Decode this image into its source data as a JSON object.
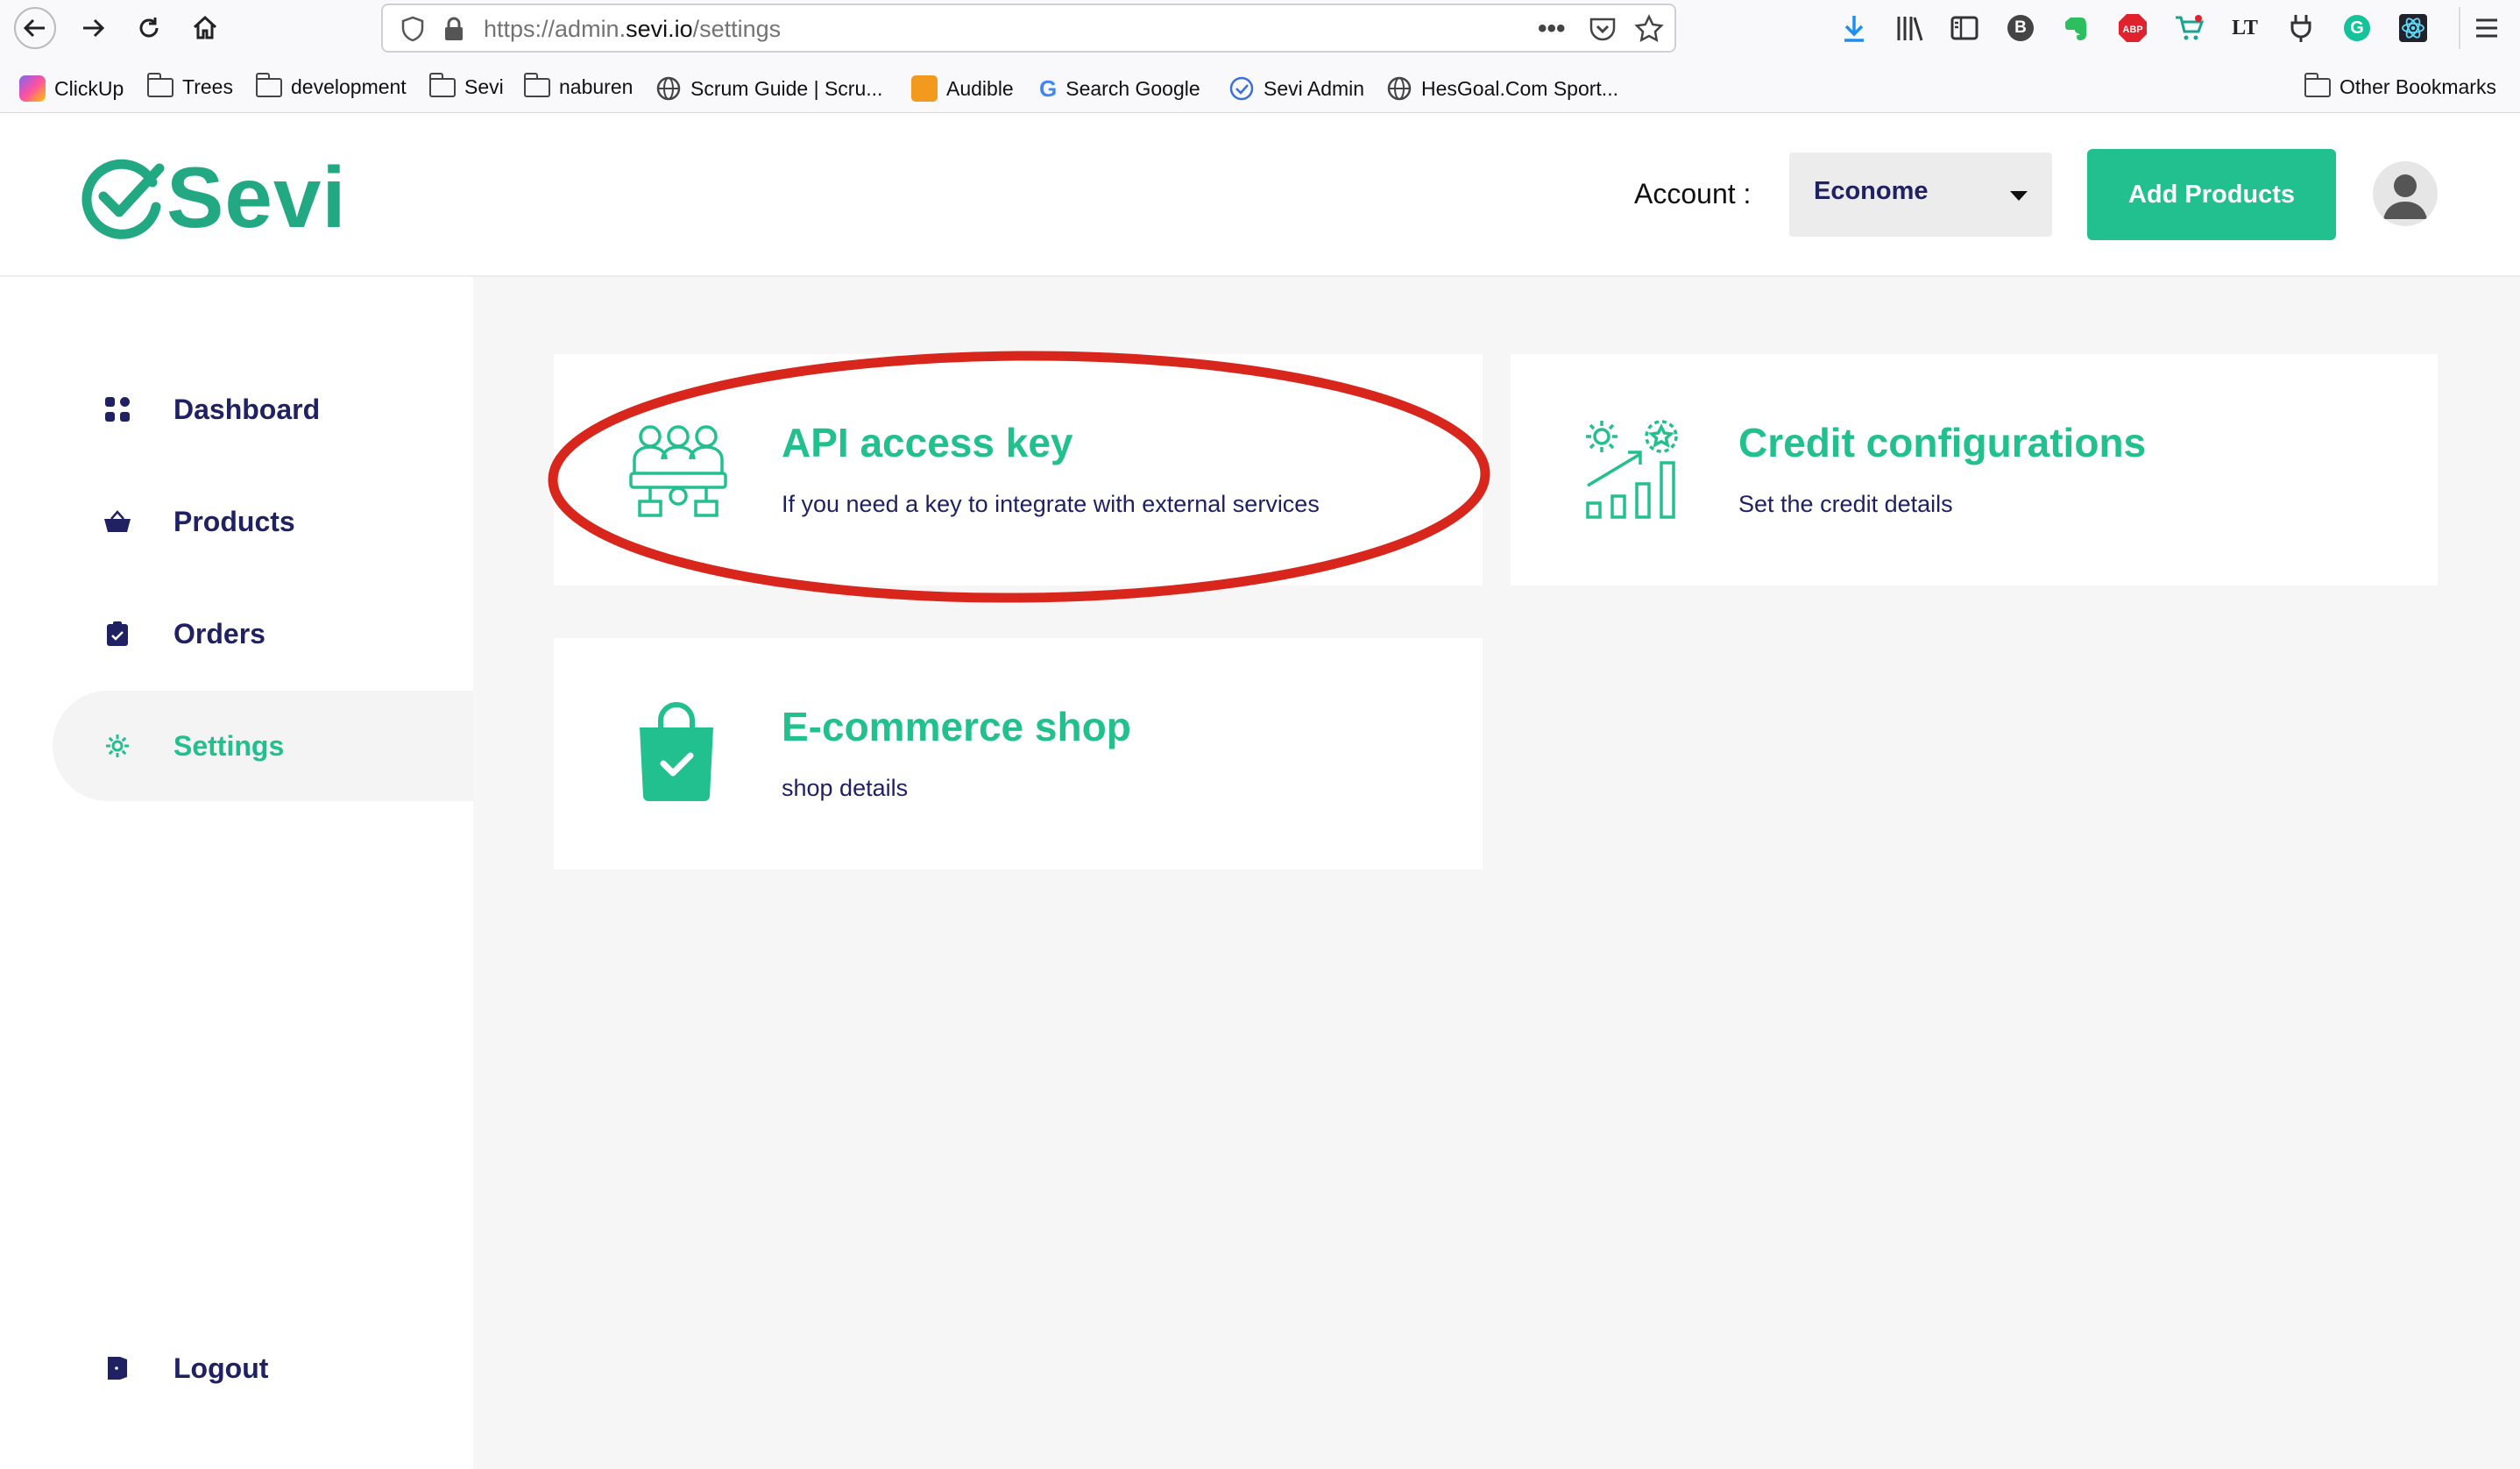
{
  "browser": {
    "url_prefix": "https://admin.",
    "url_domain": "sevi.io",
    "url_path": "/settings",
    "bookmarks": [
      "ClickUp",
      "Trees",
      "development",
      "Sevi",
      "naburen",
      "Scrum Guide | Scru...",
      "Audible",
      "Search Google",
      "Sevi Admin",
      "HesGoal.Com Sport..."
    ],
    "other_bookmarks": "Other Bookmarks"
  },
  "header": {
    "logo_text": "Sevi",
    "account_label": "Account :",
    "account_value": "Econome",
    "add_products_label": "Add Products"
  },
  "sidebar": {
    "items": [
      {
        "label": "Dashboard"
      },
      {
        "label": "Products"
      },
      {
        "label": "Orders"
      },
      {
        "label": "Settings"
      }
    ],
    "logout_label": "Logout"
  },
  "cards": [
    {
      "title": "API access key",
      "desc": "If you need a key to integrate with external services"
    },
    {
      "title": "Credit configurations",
      "desc": "Set the credit details"
    },
    {
      "title": "E-commerce shop",
      "desc": "shop details"
    }
  ],
  "colors": {
    "accent": "#22c08e",
    "navy": "#1f2163",
    "annotation": "#d9261c"
  }
}
